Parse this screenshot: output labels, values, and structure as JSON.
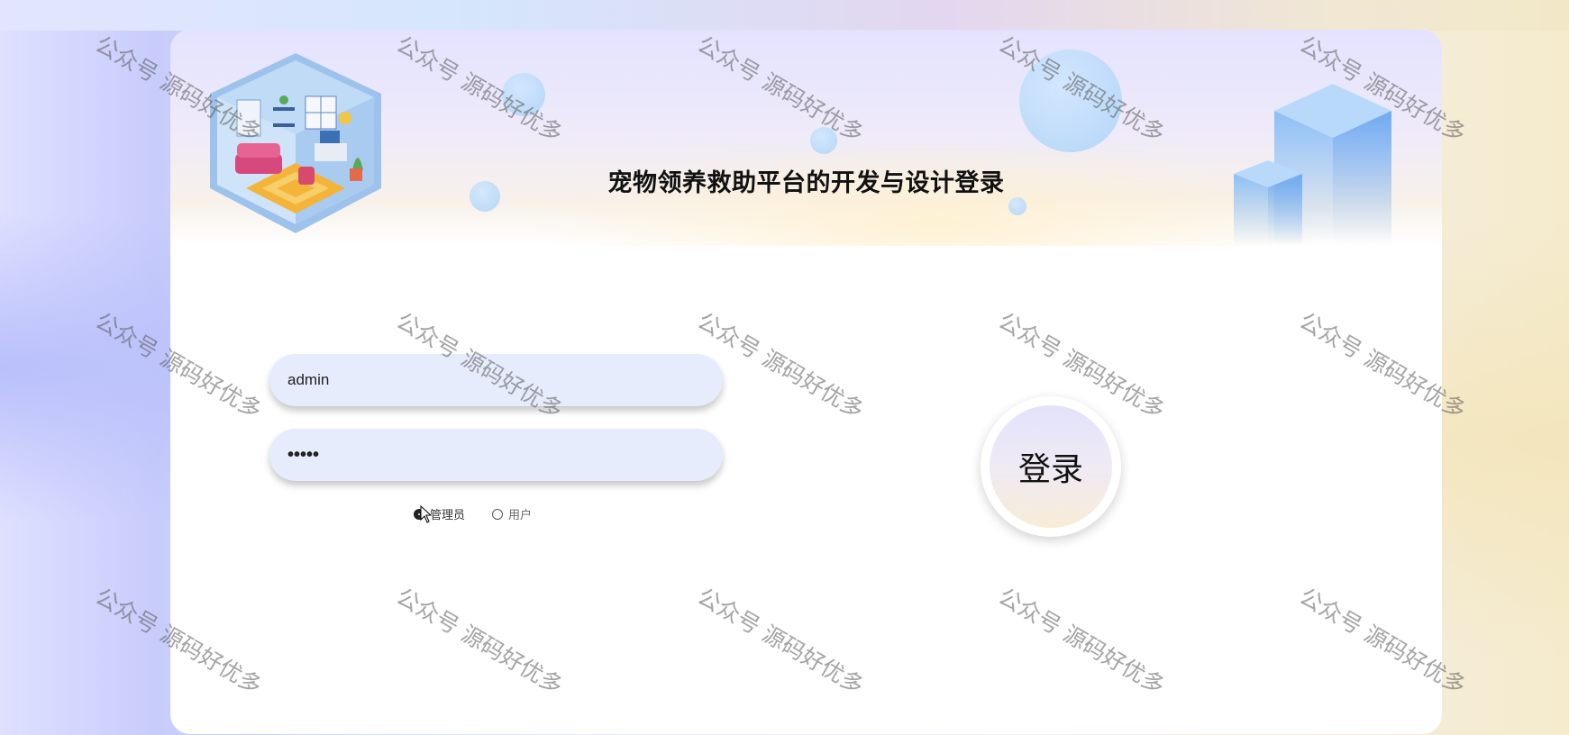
{
  "header": {
    "title": "宠物领养救助平台的开发与设计登录"
  },
  "form": {
    "username_value": "admin",
    "password_value": "•••••",
    "roles": [
      {
        "label": "管理员",
        "checked": true
      },
      {
        "label": "用户",
        "checked": false
      }
    ],
    "login_label": "登录"
  },
  "watermark": {
    "text": "公众号 源码好优多"
  },
  "icons": {
    "illustration": "isometric-room-illustration",
    "decoration": "isometric-towers-decoration",
    "cursor": "mouse-pointer-icon"
  },
  "colors": {
    "input_bg": "#e7ecfc",
    "card_bg": "#ffffff",
    "bubble": "#b4d8f9"
  }
}
